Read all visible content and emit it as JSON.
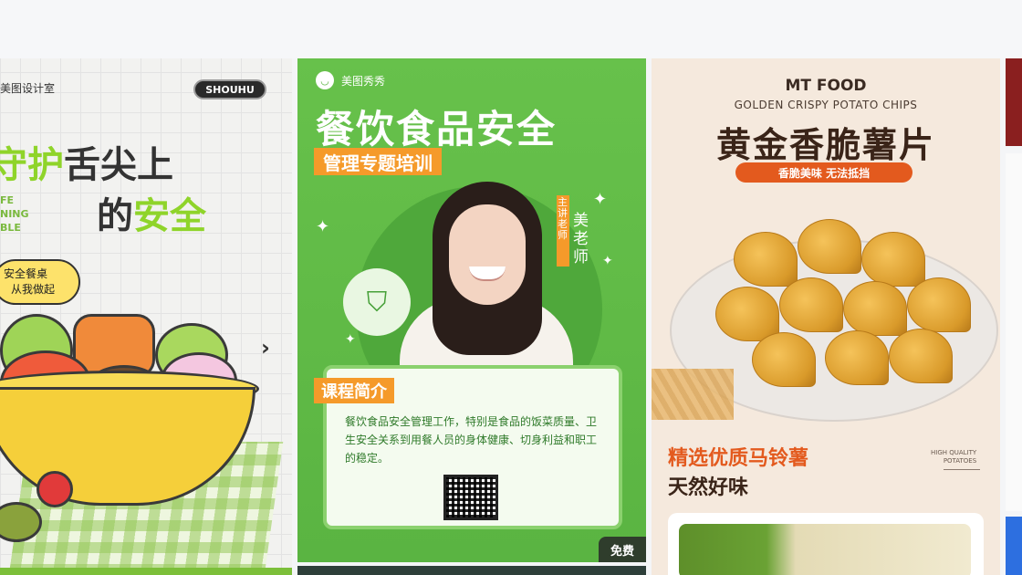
{
  "cards": [
    {
      "brand": "美图设计室",
      "badge": "SHOUHU",
      "title_line1_green": "守护",
      "title_line1_dark": "舌尖上",
      "title_line2_dark": "的",
      "title_line2_green": "安全",
      "side_text": [
        "FE",
        "NING",
        "BLE"
      ],
      "bubble_text": [
        "安全餐桌",
        "从我做起"
      ],
      "arrow": "›"
    },
    {
      "brand": "美图秀秀",
      "title": "餐饮食品安全",
      "tag": "管理专题培训",
      "teacher_role": "主讲老师",
      "teacher_name": "美老师",
      "intro_label": "课程简介",
      "intro_text": "餐饮食品安全管理工作，特别是食品的饭菜质量、卫生安全关系到用餐人员的身体健康、切身利益和职工的稳定。",
      "free_badge": "免费"
    },
    {
      "brand": "MT FOOD",
      "subtitle": "GOLDEN CRISPY POTATO CHIPS",
      "title": "黄金香脆薯片",
      "pill": "香脆美味 无法抵挡",
      "headline1": "精选优质马铃薯",
      "headline2": "天然好味",
      "hq_label": [
        "HIGH QUALITY",
        "POTATOES"
      ]
    }
  ],
  "colors": {
    "card2_green": "#5ab442",
    "accent_orange": "#f59a2a",
    "card3_orange": "#e35a1e",
    "card1_green": "#8fd42a"
  }
}
